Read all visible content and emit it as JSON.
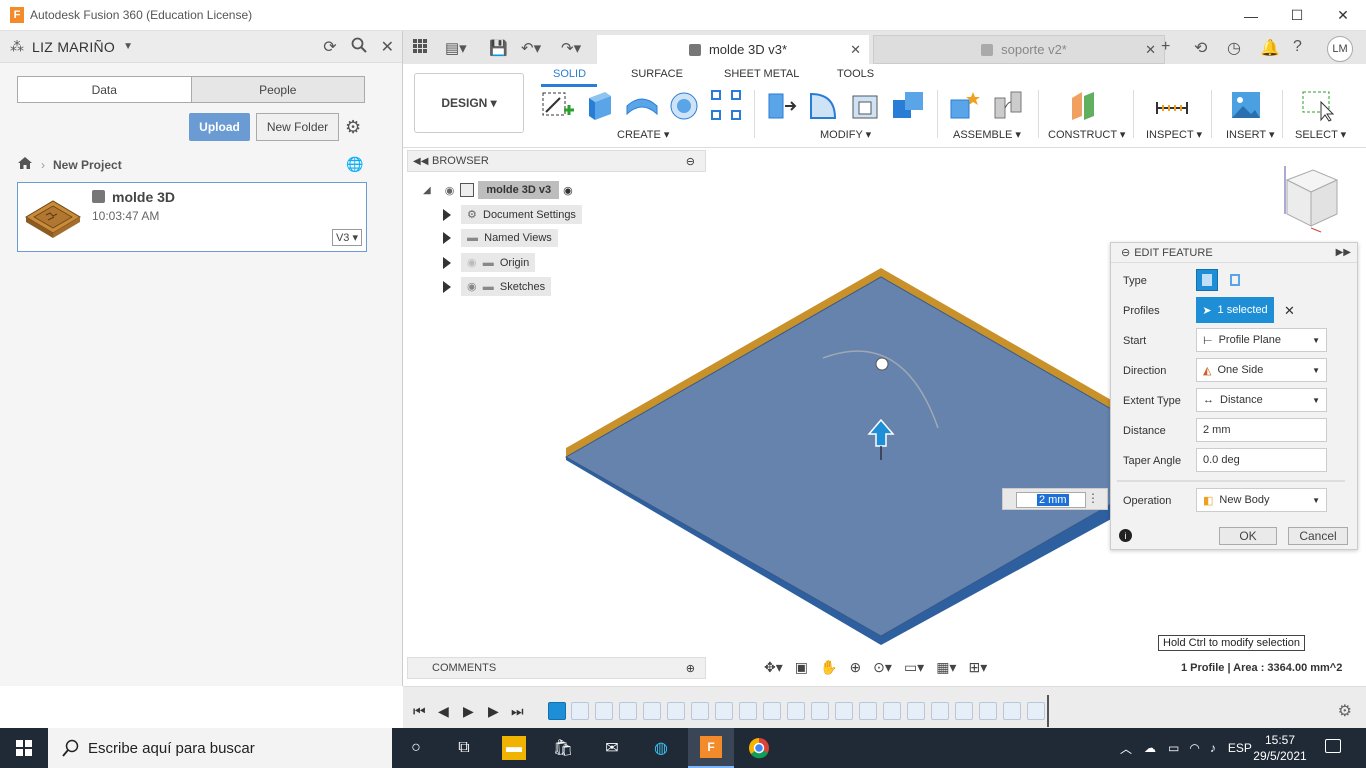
{
  "window": {
    "title": "Autodesk Fusion 360 (Education License)",
    "logo_letter": "F",
    "minimize": "—",
    "maximize": "☐",
    "close": "✕"
  },
  "data_panel": {
    "user": "LIZ MARIÑO",
    "segments": [
      "Data",
      "People"
    ],
    "upload_label": "Upload",
    "new_folder_label": "New Folder",
    "breadcrumb_project": "New Project",
    "file": {
      "name": "molde 3D",
      "time": "10:03:47 AM",
      "version": "V3"
    }
  },
  "tabs": [
    {
      "label": "molde 3D v3*",
      "close": "✕"
    },
    {
      "label": "soporte v2*",
      "close": "✕"
    }
  ],
  "header": {
    "avatar": "LM"
  },
  "toolbar": {
    "design_label": "DESIGN ▾",
    "workspace_tabs": [
      "SOLID",
      "SURFACE",
      "SHEET METAL",
      "TOOLS"
    ],
    "groups": [
      "CREATE ▾",
      "MODIFY ▾",
      "ASSEMBLE ▾",
      "CONSTRUCT ▾",
      "INSPECT ▾",
      "INSERT ▾",
      "SELECT ▾"
    ]
  },
  "browser": {
    "title": "BROWSER",
    "root": "molde 3D v3",
    "items": [
      "Document Settings",
      "Named Views",
      "Origin",
      "Sketches"
    ]
  },
  "comments": {
    "title": "COMMENTS"
  },
  "edit_feature": {
    "title": "EDIT FEATURE",
    "labels": {
      "type": "Type",
      "profiles": "Profiles",
      "start": "Start",
      "direction": "Direction",
      "extent_type": "Extent Type",
      "distance": "Distance",
      "taper_angle": "Taper Angle",
      "operation": "Operation"
    },
    "profiles_value": "1 selected",
    "start_value": "Profile Plane",
    "direction_value": "One Side",
    "extent_type_value": "Distance",
    "distance_value": "2 mm",
    "taper_angle_value": "0.0 deg",
    "operation_value": "New Body",
    "ok": "OK",
    "cancel": "Cancel"
  },
  "viewport": {
    "distance_input": "2 mm",
    "hint": "Hold Ctrl to modify selection",
    "status": "1 Profile | Area : 3364.00 mm^2"
  },
  "taskbar": {
    "search_placeholder": "Escribe aquí para buscar",
    "language": "ESP",
    "time": "15:57",
    "date": "29/5/2021"
  },
  "colors": {
    "accent": "#2a7dd6",
    "selection": "#1e8fd6",
    "body_top": "#6583ad",
    "body_edge": "#c8912a",
    "taskbar": "#1f2a36"
  }
}
